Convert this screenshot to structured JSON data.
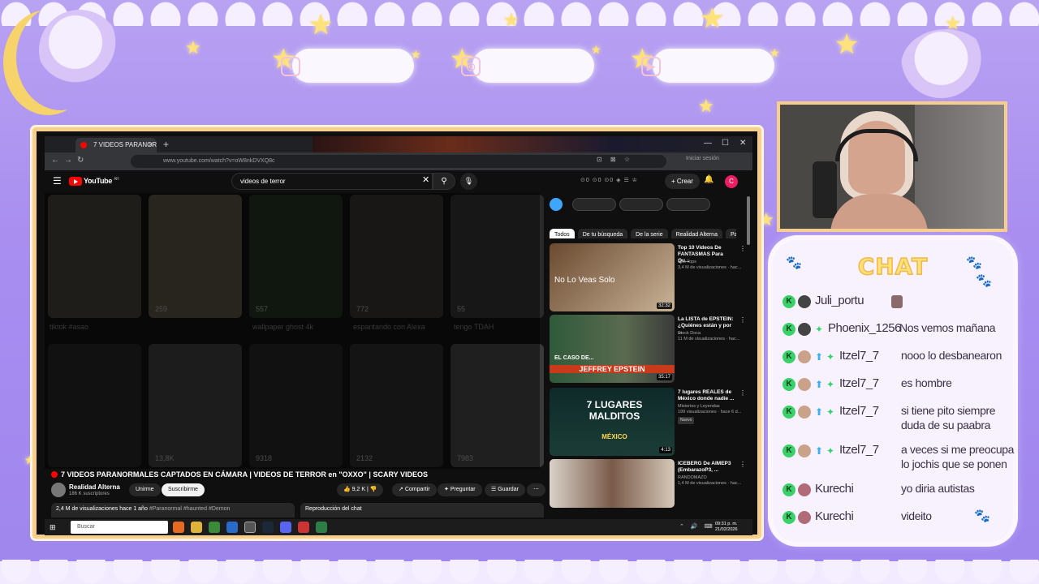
{
  "browser": {
    "tab_title": "7 VIDEOS PARANORMAL",
    "url": "www.youtube.com/watch?v=oW8nkDVXQ8c",
    "signin": "Iniciar sesión"
  },
  "youtube": {
    "logo_text": "YouTube",
    "logo_region": "AR",
    "search_query": "videos de terror",
    "create_label": "Crear",
    "avatar_letter": "C"
  },
  "shorts": [
    {
      "views": "",
      "caption": "tiktok #asao"
    },
    {
      "views": "259",
      "caption": ""
    },
    {
      "views": "557",
      "caption": "wallpaper ghost 4k"
    },
    {
      "views": "772",
      "caption": "espantando con Alexa"
    },
    {
      "views": "55",
      "caption": "tengo TDAH"
    },
    {
      "views": "",
      "caption": ""
    },
    {
      "views": "13,8K",
      "caption": ""
    },
    {
      "views": "9318",
      "caption": ""
    },
    {
      "views": "2132",
      "caption": ""
    },
    {
      "views": "7983",
      "caption": ""
    }
  ],
  "video": {
    "title": "7 VIDEOS PARANORMALES CAPTADOS EN CÁMARA | VIDEOS DE TERROR en \"OXXO\" | SCARY VIDEOS",
    "channel": "Realidad Alterna",
    "subscribers": "186 K suscriptores",
    "join_label": "Unirme",
    "subscribe_label": "Suscribirme",
    "likes": "9,2 K",
    "share_label": "Compartir",
    "ask_label": "Preguntar",
    "save_label": "Guardar",
    "meta": "2,4 M de visualizaciones  hace 1 año",
    "tags": "#Paranormal #haunted #Demon",
    "chat_replay": "Reproducción del chat"
  },
  "chips": [
    "Todos",
    "De tu búsqueda",
    "De la serie",
    "Realidad Alterna",
    "Pa"
  ],
  "recommendations": [
    {
      "title": "Top 10 Videos De FANTASMAS Para Qu...",
      "channel": "Doc Tops",
      "meta": "3,4 M de visualizaciones · hac...",
      "duration": "32:32",
      "thumb_text": "No Lo Veas Solo",
      "new": ""
    },
    {
      "title": "La LISTA de EPSTEIN: ¿Quiénes están y por ...",
      "channel": "Dieck Doca",
      "meta": "11 M de visualizaciones · hac...",
      "duration": "35:17",
      "thumb_text": "JEFFREY EPSTEIN",
      "thumb_sub": "EL CASO DE...",
      "new": ""
    },
    {
      "title": "7 lugares REALES de México donde nadie ...",
      "channel": "Misterios y Leyendas",
      "meta": "199 visualizaciones · hace 6 d...",
      "duration": "4:13",
      "thumb_text": "7 LUGARES MALDITOS",
      "thumb_sub": "MÉXICO",
      "new": "Nuevo"
    },
    {
      "title": "ICEBERG De AIMEP3 (EmbarazoP3, ...",
      "channel": "RANDOMAZO",
      "meta": "1,4 M de visualizaciones · hac...",
      "duration": "",
      "thumb_text": "",
      "new": ""
    }
  ],
  "taskbar": {
    "search_placeholder": "Buscar",
    "time": "09:31 p. m.",
    "date": "21/02/2026"
  },
  "chat": {
    "title": "CHAT",
    "messages": [
      {
        "user": "Juli_portu",
        "text": ""
      },
      {
        "user": "Phoenix_1256",
        "text": "Nos vemos mañana"
      },
      {
        "user": "Itzel7_7",
        "text": "nooo lo desbanearon"
      },
      {
        "user": "Itzel7_7",
        "text": "es hombre"
      },
      {
        "user": "Itzel7_7",
        "text": "si tiene pito siempre",
        "text2": "duda de su paabra"
      },
      {
        "user": "Itzel7_7",
        "text": "a veces si me preocupa",
        "text2": "lo jochis que se ponen"
      },
      {
        "user": "Kurechi",
        "text": "yo diria autistas"
      },
      {
        "user": "Kurechi",
        "text": "videito"
      }
    ]
  },
  "colors": {
    "accent": "#ff0000",
    "frame": "#f6cf8e",
    "overlay_bg": "#a98ef0",
    "chat_title": "#ffe27a"
  }
}
